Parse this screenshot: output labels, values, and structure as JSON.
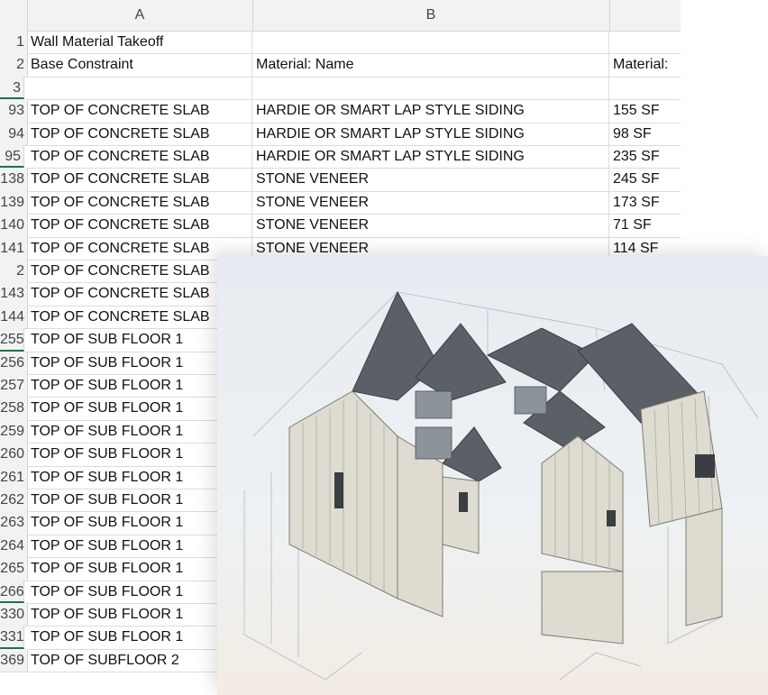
{
  "columns": [
    "A",
    "B"
  ],
  "rows": [
    {
      "num": "1",
      "a": "Wall Material Takeoff",
      "b": "",
      "c": ""
    },
    {
      "num": "2",
      "a": "Base Constraint",
      "b": "Material: Name",
      "c": "Material:"
    },
    {
      "num": "3",
      "a": "",
      "b": "",
      "c": ""
    },
    {
      "num": "93",
      "a": "TOP OF CONCRETE SLAB",
      "b": "HARDIE OR SMART LAP STYLE SIDING",
      "c": "155 SF"
    },
    {
      "num": "94",
      "a": "TOP OF CONCRETE SLAB",
      "b": "HARDIE OR SMART LAP STYLE SIDING",
      "c": "98 SF"
    },
    {
      "num": "95",
      "a": "TOP OF CONCRETE SLAB",
      "b": "HARDIE OR SMART LAP STYLE SIDING",
      "c": "235 SF"
    },
    {
      "num": "138",
      "a": "TOP OF CONCRETE SLAB",
      "b": "STONE VENEER",
      "c": "245 SF"
    },
    {
      "num": "139",
      "a": "TOP OF CONCRETE SLAB",
      "b": "STONE VENEER",
      "c": "173 SF"
    },
    {
      "num": "140",
      "a": "TOP OF CONCRETE SLAB",
      "b": "STONE VENEER",
      "c": "71 SF"
    },
    {
      "num": "141",
      "a": "TOP OF CONCRETE SLAB",
      "b": "STONE VENEER",
      "c": "114 SF"
    },
    {
      "num": "2",
      "a": "TOP OF CONCRETE SLAB",
      "b": "",
      "c": ""
    },
    {
      "num": "143",
      "a": "TOP OF CONCRETE SLAB",
      "b": "",
      "c": ""
    },
    {
      "num": "144",
      "a": "TOP OF CONCRETE SLAB",
      "b": "",
      "c": ""
    },
    {
      "num": "255",
      "a": "TOP OF SUB FLOOR 1",
      "b": "",
      "c": ""
    },
    {
      "num": "256",
      "a": "TOP OF SUB FLOOR 1",
      "b": "",
      "c": ""
    },
    {
      "num": "257",
      "a": "TOP OF SUB FLOOR 1",
      "b": "",
      "c": ""
    },
    {
      "num": "258",
      "a": "TOP OF SUB FLOOR 1",
      "b": "",
      "c": ""
    },
    {
      "num": "259",
      "a": "TOP OF SUB FLOOR 1",
      "b": "",
      "c": ""
    },
    {
      "num": "260",
      "a": "TOP OF SUB FLOOR 1",
      "b": "",
      "c": ""
    },
    {
      "num": "261",
      "a": "TOP OF SUB FLOOR 1",
      "b": "",
      "c": ""
    },
    {
      "num": "262",
      "a": "TOP OF SUB FLOOR 1",
      "b": "",
      "c": ""
    },
    {
      "num": "263",
      "a": "TOP OF SUB FLOOR 1",
      "b": "",
      "c": ""
    },
    {
      "num": "264",
      "a": "TOP OF SUB FLOOR 1",
      "b": "",
      "c": ""
    },
    {
      "num": "265",
      "a": "TOP OF SUB FLOOR 1",
      "b": "",
      "c": ""
    },
    {
      "num": "266",
      "a": "TOP OF SUB FLOOR 1",
      "b": "",
      "c": ""
    },
    {
      "num": "330",
      "a": "TOP OF SUB FLOOR 1",
      "b": "",
      "c": ""
    },
    {
      "num": "331",
      "a": "TOP OF SUB FLOOR 1",
      "b": "",
      "c": ""
    },
    {
      "num": "369",
      "a": "TOP OF SUBFLOOR 2",
      "b": "",
      "c": ""
    }
  ]
}
